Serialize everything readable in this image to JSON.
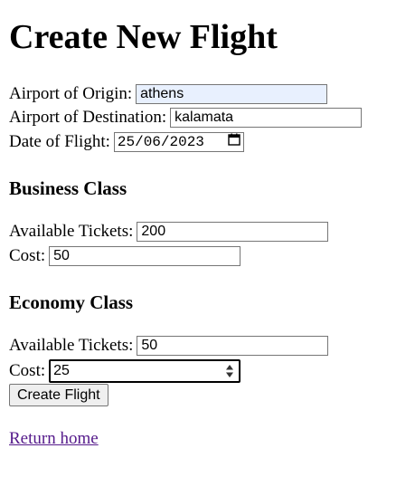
{
  "page": {
    "title": "Create New Flight"
  },
  "form": {
    "origin": {
      "label": "Airport of Origin:",
      "value": "athens"
    },
    "destination": {
      "label": "Airport of Destination:",
      "value": "kalamata"
    },
    "date": {
      "label": "Date of Flight:",
      "value": "25/06/2023"
    }
  },
  "business": {
    "heading": "Business Class",
    "tickets": {
      "label": "Available Tickets:",
      "value": "200"
    },
    "cost": {
      "label": "Cost:",
      "value": "50"
    }
  },
  "economy": {
    "heading": "Economy Class",
    "tickets": {
      "label": "Available Tickets:",
      "value": "50"
    },
    "cost": {
      "label": "Cost:",
      "value": "25"
    }
  },
  "actions": {
    "submit_label": "Create Flight",
    "return_link": "Return home"
  },
  "icons": {
    "calendar": "calendar-icon",
    "spinner": "spin-up-down-icon"
  },
  "colors": {
    "autofill_bg": "#e8f0fe",
    "visited_link": "#551a8b",
    "button_bg": "#efefef"
  }
}
